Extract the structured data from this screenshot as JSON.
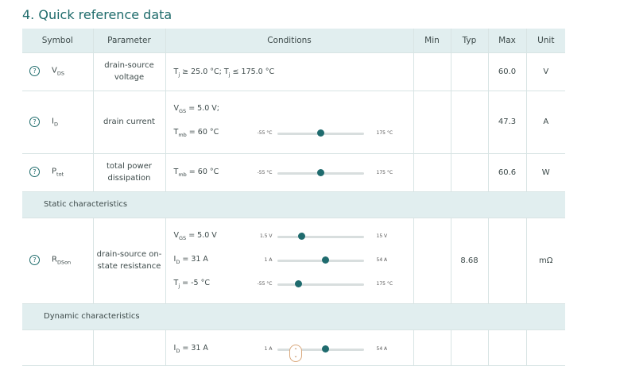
{
  "page_title": "4. Quick reference data",
  "headers": {
    "symbol": "Symbol",
    "parameter": "Parameter",
    "conditions": "Conditions",
    "min": "Min",
    "typ": "Typ",
    "max": "Max",
    "unit": "Unit"
  },
  "help_glyph": "?",
  "rows": {
    "vds": {
      "symbol": "V",
      "symbol_sub": "DS",
      "param_l1": "drain-source",
      "param_l2": "voltage",
      "cond_a1": "T",
      "cond_a1_sub": "j",
      "cond_a2": " ≥ 25.0 °C; T",
      "cond_a2_sub": "j",
      "cond_a3": " ≤ 175.0 °C",
      "min": "",
      "typ": "",
      "max": "60.0",
      "unit": "V"
    },
    "id": {
      "symbol": "I",
      "symbol_sub": "D",
      "param": "drain current",
      "cond1": "V",
      "cond1_sub": "GS",
      "cond1_rest": " = 5.0 V;",
      "cond2": "T",
      "cond2_sub": "mb",
      "cond2_rest": " = 60 °C",
      "slider_min": "-55 °C",
      "slider_max": "175 °C",
      "slider_value": 60,
      "min": "",
      "typ": "",
      "max": "47.3",
      "unit": "A"
    },
    "ptot": {
      "symbol": "P",
      "symbol_sub": "tot",
      "param_l1": "total power",
      "param_l2": "dissipation",
      "cond1": "T",
      "cond1_sub": "mb",
      "cond1_rest": " = 60 °C",
      "slider_min": "-55 °C",
      "slider_max": "175 °C",
      "slider_value": 60,
      "min": "",
      "typ": "",
      "max": "60.6",
      "unit": "W"
    },
    "rdson": {
      "symbol": "R",
      "symbol_sub": "DSon",
      "param_l1": "drain-source on-",
      "param_l2": "state resistance",
      "cond1": "V",
      "cond1_sub": "GS",
      "cond1_rest": " = 5.0 V",
      "s1_min": "1.5 V",
      "s1_max": "15 V",
      "s1_value": 5.0,
      "cond2": "I",
      "cond2_sub": "D",
      "cond2_rest": " = 31 A",
      "s2_min": "1 A",
      "s2_max": "54 A",
      "s2_value": 31,
      "cond3": "T",
      "cond3_sub": "j",
      "cond3_rest": " = -5 °C",
      "s3_min": "-55 °C",
      "s3_max": "175 °C",
      "s3_value": -5,
      "min": "",
      "typ": "8.68",
      "max": "",
      "unit": "mΩ"
    },
    "dyn1": {
      "cond1": "I",
      "cond1_sub": "D",
      "cond1_rest": " = 31 A",
      "s1_min": "1 A",
      "s1_max": "54 A",
      "s1_value": 31
    }
  },
  "sections": {
    "static": "Static characteristics",
    "dynamic": "Dynamic characteristics"
  },
  "scroll": {
    "up": "⌃",
    "down": "⌄"
  },
  "colors": {
    "accent": "#1e6b6b",
    "header_bg": "#e1eeef",
    "thumb": "#1f6b6e"
  }
}
